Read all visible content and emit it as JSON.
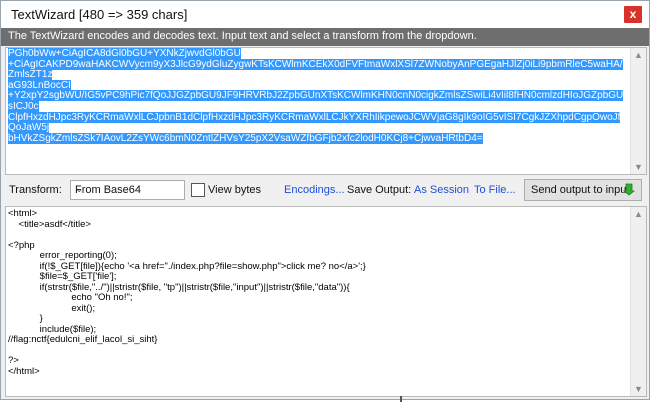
{
  "window": {
    "title": "TextWizard [480 => 359 chars]",
    "close_label": "x",
    "info": "The TextWizard encodes and decodes text. Input text and select a transform from the dropdown."
  },
  "input": {
    "lines": [
      "PGh0bWw+CiAgICA8dGl0bGU+YXNkZjwvdGl0bGU",
      "+CiAgICAKPD9waHAKCWVycm9yX3JlcG9ydGluZygwKTsKCWlmKCEkX0dFVFtmaWxlXSl7ZWNobyAnPGEgaHJlZj0iLi9pbmRleC5waHA/ZmlsZT1z",
      "aG93LnBocCI",
      "+Y2xpY2sgbWU/IG5vPC9hPic7fQoJJGZpbGU9JF9HRVRbJ2ZpbGUnXTsKCWlmKHN0cnN0cigkZmlsZSwiLi4vIil8fHN0cmlzdHIoJGZpbGUsICJ0c",
      "ClpfHxzdHJpc3RyKCRmaWxlLCJpbnB1dClpfHxzdHJpc3RyKCRmaWxlLCJkYXRhIikpewoJCWVjaG8gIk9oIG5vISI7CgkJZXhpdCgpOwoJfQoJaW5j",
      "bHVkZSgkZmlsZSk7IAovL2ZsYWc6bmN0ZntlZHVsY25pX2VsaWZfbGFjb2xfc2lodH0KCj8+CjwvaHRtbD4="
    ]
  },
  "toolbar": {
    "transform_label": "Transform:",
    "transform_value": "From Base64",
    "view_bytes_label": "View bytes",
    "encodings_link": "Encodings...",
    "save_output_label": "Save Output:",
    "as_session_link": "As Session",
    "to_file_link": "To File...",
    "send_button_label": "Send output to input"
  },
  "output": {
    "lines": [
      "<html>",
      "    <title>asdf</title>",
      "",
      "<?php",
      "            error_reporting(0);",
      "            if(!$_GET[file]){echo '<a href=\"./index.php?file=show.php\">click me? no</a>';}",
      "            $file=$_GET['file'];",
      "            if(strstr($file,\"../\")||stristr($file, \"tp\")||stristr($file,\"input\")||stristr($file,\"data\")){",
      "                        echo \"Oh no!\";",
      "                        exit();",
      "            }",
      "            include($file);",
      "//flag:nctf{edulcni_elif_lacol_si_siht}",
      "",
      "?>",
      "</html>"
    ]
  },
  "colors": {
    "selection": "#3399ff",
    "link": "#1f4fd6",
    "close": "#d9322a",
    "infobar": "#6e6e6e"
  }
}
